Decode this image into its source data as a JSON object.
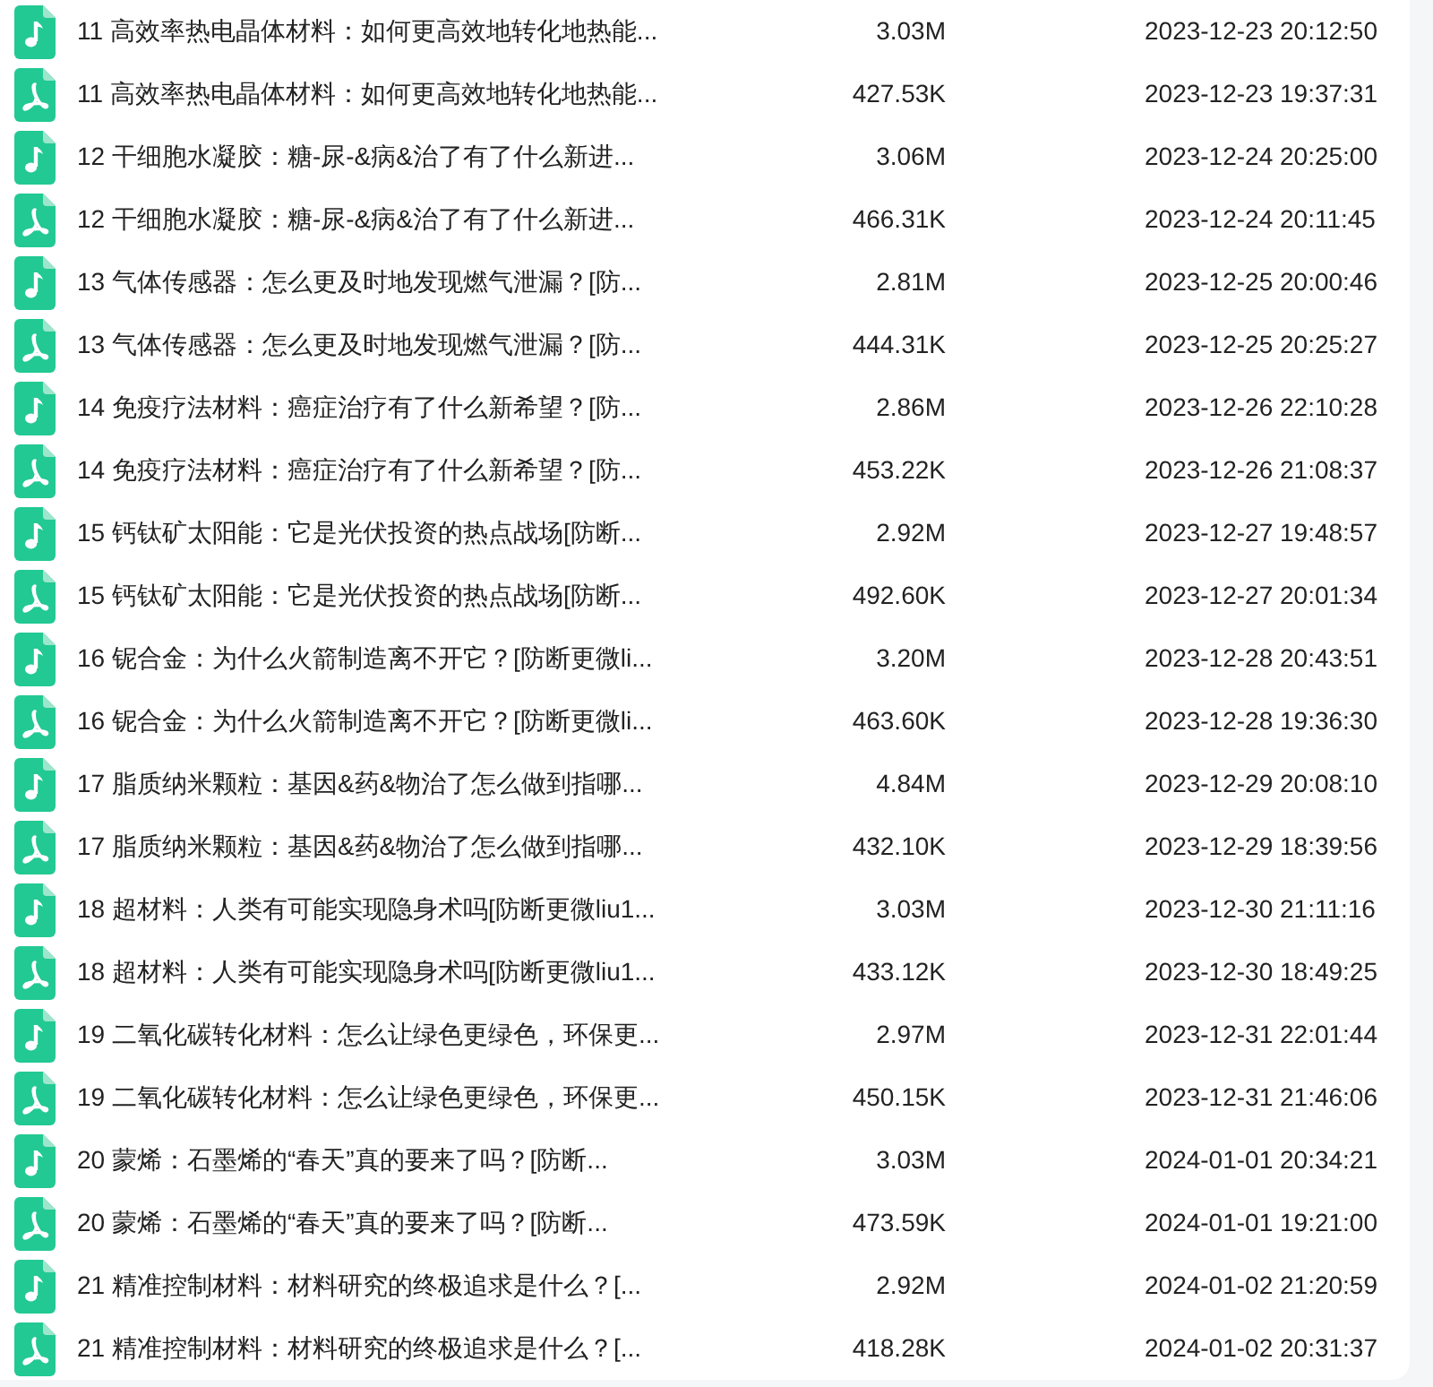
{
  "files": [
    {
      "kind": "audio",
      "name": "11 高效率热电晶体材料：如何更高效地转化地热能...",
      "size": "3.03M",
      "date": "2023-12-23 20:12:50"
    },
    {
      "kind": "pdf",
      "name": "11 高效率热电晶体材料：如何更高效地转化地热能...",
      "size": "427.53K",
      "date": "2023-12-23 19:37:31"
    },
    {
      "kind": "audio",
      "name": "12 干细胞水凝胶：糖-尿-&病&治了有了什么新进...",
      "size": "3.06M",
      "date": "2023-12-24 20:25:00"
    },
    {
      "kind": "pdf",
      "name": "12 干细胞水凝胶：糖-尿-&病&治了有了什么新进...",
      "size": "466.31K",
      "date": "2023-12-24 20:11:45"
    },
    {
      "kind": "audio",
      "name": "13 气体传感器：怎么更及时地发现燃气泄漏？[防...",
      "size": "2.81M",
      "date": "2023-12-25 20:00:46"
    },
    {
      "kind": "pdf",
      "name": "13 气体传感器：怎么更及时地发现燃气泄漏？[防...",
      "size": "444.31K",
      "date": "2023-12-25 20:25:27"
    },
    {
      "kind": "audio",
      "name": "14 免疫疗法材料：癌症治疗有了什么新希望？[防...",
      "size": "2.86M",
      "date": "2023-12-26 22:10:28"
    },
    {
      "kind": "pdf",
      "name": "14 免疫疗法材料：癌症治疗有了什么新希望？[防...",
      "size": "453.22K",
      "date": "2023-12-26 21:08:37"
    },
    {
      "kind": "audio",
      "name": "15 钙钛矿太阳能：它是光伏投资的热点战场[防断...",
      "size": "2.92M",
      "date": "2023-12-27 19:48:57"
    },
    {
      "kind": "pdf",
      "name": "15 钙钛矿太阳能：它是光伏投资的热点战场[防断...",
      "size": "492.60K",
      "date": "2023-12-27 20:01:34"
    },
    {
      "kind": "audio",
      "name": "16 铌合金：为什么火箭制造离不开它？[防断更微li...",
      "size": "3.20M",
      "date": "2023-12-28 20:43:51"
    },
    {
      "kind": "pdf",
      "name": "16 铌合金：为什么火箭制造离不开它？[防断更微li...",
      "size": "463.60K",
      "date": "2023-12-28 19:36:30"
    },
    {
      "kind": "audio",
      "name": "17 脂质纳米颗粒：基因&药&物治了怎么做到指哪...",
      "size": "4.84M",
      "date": "2023-12-29 20:08:10"
    },
    {
      "kind": "pdf",
      "name": "17 脂质纳米颗粒：基因&药&物治了怎么做到指哪...",
      "size": "432.10K",
      "date": "2023-12-29 18:39:56"
    },
    {
      "kind": "audio",
      "name": "18 超材料：人类有可能实现隐身术吗[防断更微liu1...",
      "size": "3.03M",
      "date": "2023-12-30 21:11:16"
    },
    {
      "kind": "pdf",
      "name": "18 超材料：人类有可能实现隐身术吗[防断更微liu1...",
      "size": "433.12K",
      "date": "2023-12-30 18:49:25"
    },
    {
      "kind": "audio",
      "name": "19 二氧化碳转化材料：怎么让绿色更绿色，环保更...",
      "size": "2.97M",
      "date": "2023-12-31 22:01:44"
    },
    {
      "kind": "pdf",
      "name": "19 二氧化碳转化材料：怎么让绿色更绿色，环保更...",
      "size": "450.15K",
      "date": "2023-12-31 21:46:06"
    },
    {
      "kind": "audio",
      "name": "20 蒙烯：石墨烯的“春天”真的要来了吗？[防断...",
      "size": "3.03M",
      "date": "2024-01-01 20:34:21"
    },
    {
      "kind": "pdf",
      "name": "20 蒙烯：石墨烯的“春天”真的要来了吗？[防断...",
      "size": "473.59K",
      "date": "2024-01-01 19:21:00"
    },
    {
      "kind": "audio",
      "name": "21 精准控制材料：材料研究的终极追求是什么？[...",
      "size": "2.92M",
      "date": "2024-01-02 21:20:59"
    },
    {
      "kind": "pdf",
      "name": "21 精准控制材料：材料研究的终极追求是什么？[...",
      "size": "418.28K",
      "date": "2024-01-02 20:31:37"
    }
  ]
}
